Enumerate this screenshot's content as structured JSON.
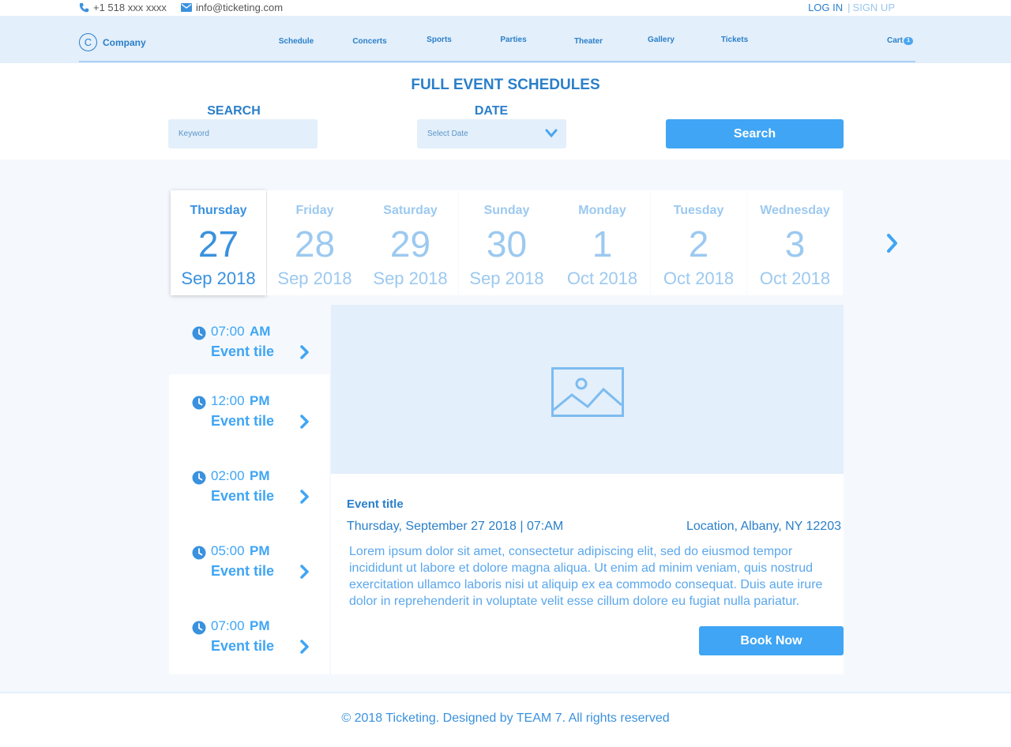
{
  "topbar": {
    "phone": "+1 518 xxx xxxx",
    "email": "info@ticketing.com",
    "login": "LOG IN",
    "separator": "|",
    "signup": "SIGN UP"
  },
  "header": {
    "logo_letter": "C",
    "company": "Company",
    "nav": [
      "Schedule",
      "Concerts",
      "Sports",
      "Parties",
      "Theater",
      "Gallery",
      "Tickets"
    ],
    "cart_label": "Cart",
    "cart_count": "1"
  },
  "search": {
    "title": "FULL EVENT SCHEDULES",
    "search_label": "SEARCH",
    "keyword_placeholder": "Keyword",
    "date_label": "DATE",
    "date_placeholder": "Select Date",
    "button": "Search"
  },
  "days": [
    {
      "name": "Thursday",
      "num": "27",
      "month": "Sep 2018",
      "active": true
    },
    {
      "name": "Friday",
      "num": "28",
      "month": "Sep 2018"
    },
    {
      "name": "Saturday",
      "num": "29",
      "month": "Sep 2018"
    },
    {
      "name": "Sunday",
      "num": "30",
      "month": "Sep 2018"
    },
    {
      "name": "Monday",
      "num": "1",
      "month": "Oct 2018"
    },
    {
      "name": "Tuesday",
      "num": "2",
      "month": "Oct 2018"
    },
    {
      "name": "Wednesday",
      "num": "3",
      "month": "Oct 2018"
    }
  ],
  "slots": [
    {
      "time": "07:00",
      "ampm": "AM",
      "title": "Event tile"
    },
    {
      "time": "12:00",
      "ampm": "PM",
      "title": "Event tile"
    },
    {
      "time": "02:00",
      "ampm": "PM",
      "title": "Event tile"
    },
    {
      "time": "05:00",
      "ampm": "PM",
      "title": "Event tile"
    },
    {
      "time": "07:00",
      "ampm": "PM",
      "title": "Event tile"
    }
  ],
  "event": {
    "title": "Event title",
    "datetime": "Thursday, September 27 2018 | 07:AM",
    "location": "Location, Albany, NY 12203",
    "description": "Lorem ipsum dolor sit amet, consectetur adipiscing elit, sed do eiusmod tempor incididunt ut labore et dolore magna aliqua. Ut enim ad minim veniam, quis nostrud exercitation ullamco laboris nisi ut aliquip ex ea commodo consequat. Duis aute irure dolor in reprehenderit in voluptate velit esse cillum dolore eu fugiat nulla pariatur.",
    "book_button": "Book Now"
  },
  "footer": {
    "text": "© 2018 Ticketing. Designed by TEAM 7. All rights reserved"
  },
  "colors": {
    "primary": "#3fa5f4",
    "text_blue": "#2a7fc9",
    "light_bg": "#e3effb"
  }
}
